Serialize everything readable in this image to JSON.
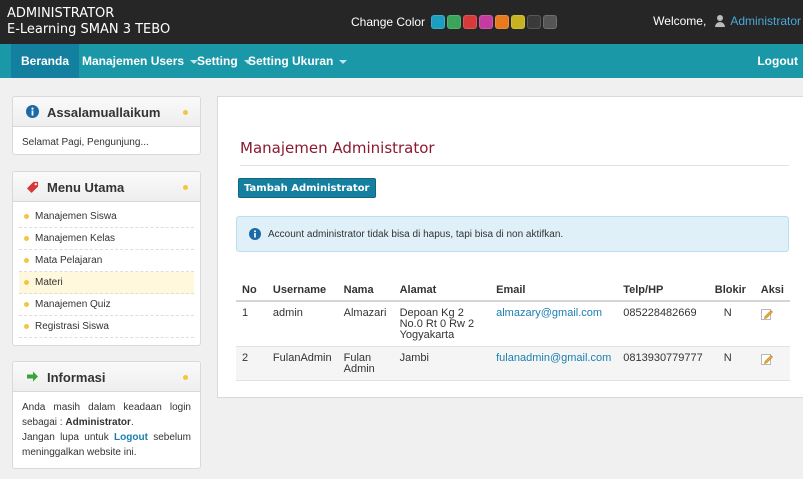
{
  "header": {
    "brand_line1": "ADMINISTRATOR",
    "brand_line2": "E-Learning SMAN 3 TEBO",
    "change_color_label": "Change Color",
    "color_swatches": [
      "#1a9fc0",
      "#3aa45a",
      "#d73a3a",
      "#c53ca0",
      "#e87a1e",
      "#c6b31f",
      "#3a3a3a",
      "#555555"
    ],
    "welcome_label": "Welcome,",
    "welcome_user": "Administrator"
  },
  "nav": {
    "items": [
      {
        "label": "Beranda",
        "dropdown": false
      },
      {
        "label": "Manajemen Users",
        "dropdown": true
      },
      {
        "label": "Setting",
        "dropdown": true
      },
      {
        "label": "Setting Ukuran",
        "dropdown": true
      }
    ],
    "logout_label": "Logout"
  },
  "sidebar": {
    "greeting": {
      "title": "Assalamuallaikum",
      "text": "Selamat Pagi, Pengunjung..."
    },
    "menu": {
      "title": "Menu Utama",
      "items": [
        "Manajemen Siswa",
        "Manajemen Kelas",
        "Mata Pelajaran",
        "Materi",
        "Manajemen Quiz",
        "Registrasi Siswa"
      ],
      "active_item": "Materi"
    },
    "info": {
      "title": "Informasi",
      "line1": "Anda masih dalam keadaan login sebagai :",
      "role": "Administrator",
      "line2_pre": "Jangan lupa untuk",
      "logout_link": "Logout",
      "line2_post": "sebelum meninggalkan website ini."
    }
  },
  "main": {
    "page_title": "Manajemen Administrator",
    "add_button": "Tambah Administrator",
    "alert_text": "Account administrator tidak bisa di hapus, tapi bisa di non aktifkan.",
    "table": {
      "columns": [
        "No",
        "Username",
        "Nama",
        "Alamat",
        "Email",
        "Telp/HP",
        "Blokir",
        "Aksi"
      ],
      "rows": [
        {
          "no": "1",
          "username": "admin",
          "nama": "Almazari",
          "alamat": "Depoan Kg 2 No.0 Rt 0 Rw 2 Yogyakarta",
          "email": "almazary@gmail.com",
          "telp": "085228482669",
          "blokir": "N"
        },
        {
          "no": "2",
          "username": "FulanAdmin",
          "nama": "Fulan Admin",
          "alamat": "Jambi",
          "email": "fulanadmin@gmail.com",
          "telp": "0813930779777",
          "blokir": "N"
        }
      ]
    }
  }
}
